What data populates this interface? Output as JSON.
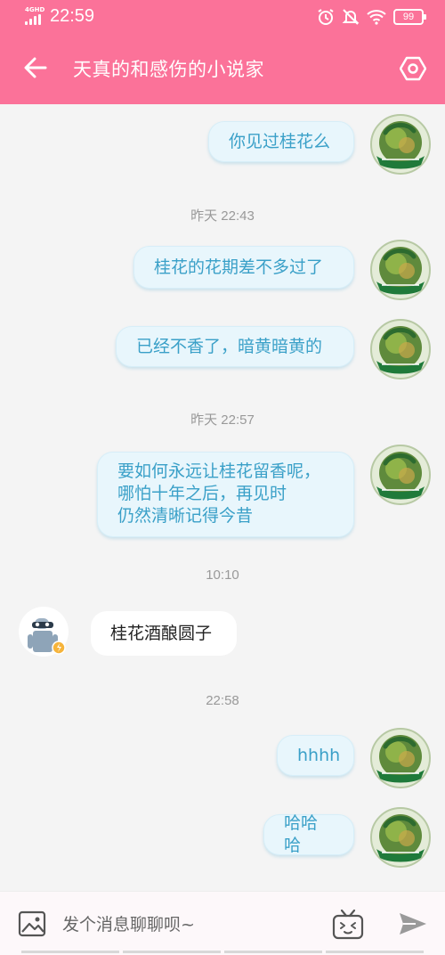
{
  "status_bar": {
    "network": "4GHD",
    "time": "22:59",
    "battery": "99"
  },
  "header": {
    "title": "天真的和感伤的小说家"
  },
  "messages": [
    {
      "type": "out",
      "text": "你见过桂花么"
    },
    {
      "type": "time",
      "text": "昨天 22:43"
    },
    {
      "type": "out",
      "text": "桂花的花期差不多过了"
    },
    {
      "type": "out",
      "text": "已经不香了，暗黄暗黄的"
    },
    {
      "type": "time",
      "text": "昨天 22:57"
    },
    {
      "type": "out",
      "lines": [
        "要如何永远让桂花留香呢，",
        "哪怕十年之后，再见时",
        "仍然清晰记得今昔"
      ]
    },
    {
      "type": "time",
      "text": "10:10"
    },
    {
      "type": "in",
      "text": "桂花酒酿圆子"
    },
    {
      "type": "time",
      "text": "22:58"
    },
    {
      "type": "out",
      "text": "hhhh"
    },
    {
      "type": "out",
      "text": "哈哈哈"
    }
  ],
  "input": {
    "placeholder": "发个消息聊聊呗~"
  },
  "colors": {
    "header": "#fb7299",
    "bubble_out_bg": "#e8f6fc",
    "bubble_out_text": "#3aa0c8",
    "background": "#f4f4f4"
  },
  "icons": [
    "back-arrow-icon",
    "settings-icon",
    "image-icon",
    "emoji-tv-icon",
    "send-icon",
    "alarm-icon",
    "bell-mute-icon",
    "wifi-icon"
  ]
}
